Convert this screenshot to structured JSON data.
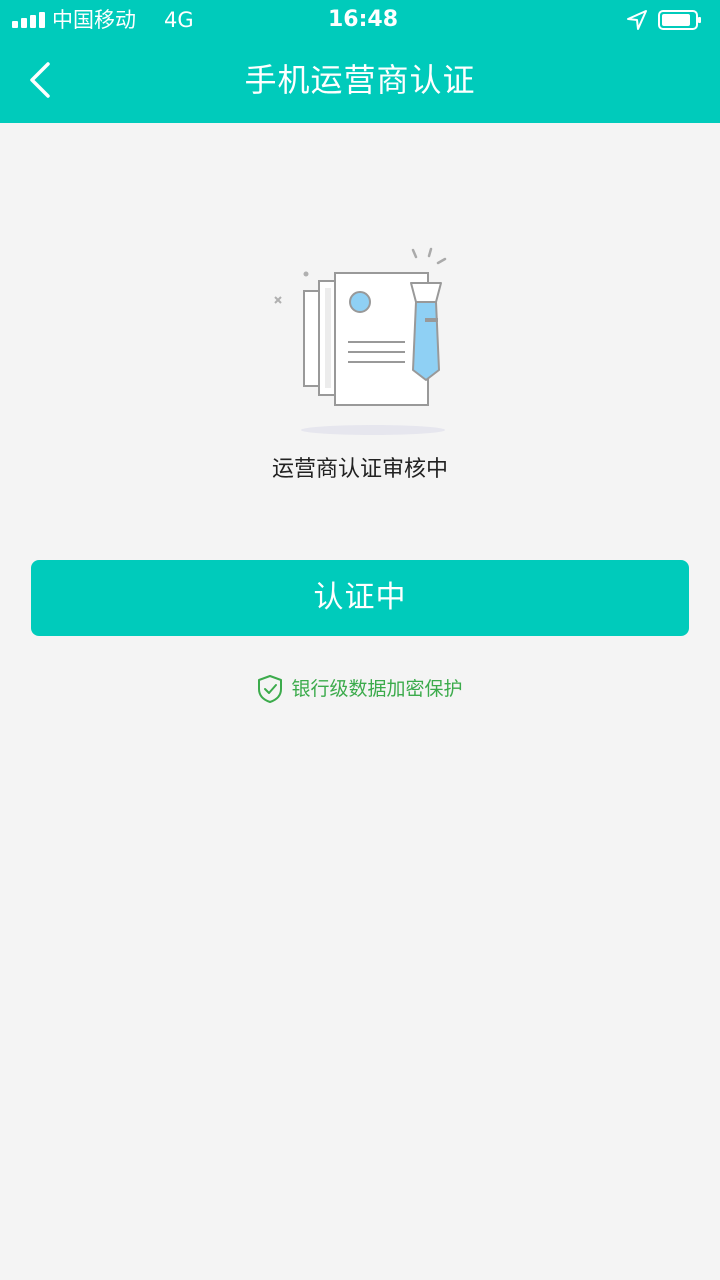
{
  "status_bar": {
    "carrier": "中国移动",
    "network": "4G",
    "time": "16:48"
  },
  "nav": {
    "title": "手机运营商认证",
    "back_icon": "chevron-left-icon"
  },
  "content": {
    "illustration_icon": "document-with-tie-illustration",
    "status_text": "运营商认证审核中",
    "button_label": "认证中",
    "security_icon": "shield-check-icon",
    "security_text": "银行级数据加密保护"
  },
  "colors": {
    "brand": "#00cbbb",
    "background": "#f4f4f4",
    "security_green": "#3cab4c",
    "tie_blue": "#8fd0f4"
  }
}
